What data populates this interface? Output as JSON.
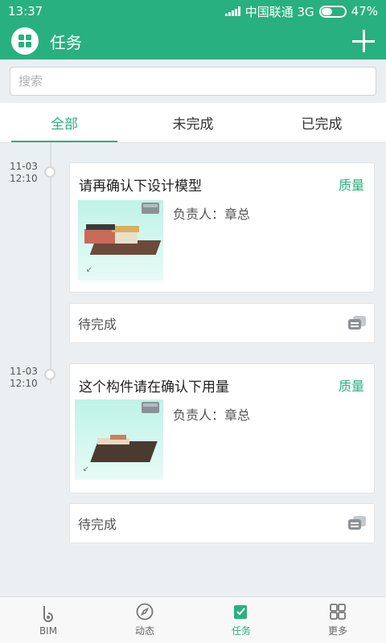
{
  "status_bar": {
    "time": "13:37",
    "carrier": "中国联通 3G",
    "battery": "47%"
  },
  "app_bar": {
    "title": "任务"
  },
  "search": {
    "placeholder": "搜索"
  },
  "tabs": [
    {
      "label": "全部",
      "active": true
    },
    {
      "label": "未完成",
      "active": false
    },
    {
      "label": "已完成",
      "active": false
    }
  ],
  "tasks": [
    {
      "date": "11-03",
      "time": "12:10",
      "title": "请再确认下设计模型",
      "tag": "质量",
      "assignee": "负责人：章总",
      "status": "待完成"
    },
    {
      "date": "11-03",
      "time": "12:10",
      "title": "这个构件请在确认下用量",
      "tag": "质量",
      "assignee": "负责人：章总",
      "status": "待完成"
    }
  ],
  "bottom_nav": [
    {
      "label": "BIM",
      "icon": "bim-icon",
      "active": false
    },
    {
      "label": "动态",
      "icon": "compass-icon",
      "active": false
    },
    {
      "label": "任务",
      "icon": "task-icon",
      "active": true
    },
    {
      "label": "更多",
      "icon": "more-icon",
      "active": false
    }
  ],
  "colors": {
    "accent": "#29b080",
    "background": "#eceff1"
  }
}
